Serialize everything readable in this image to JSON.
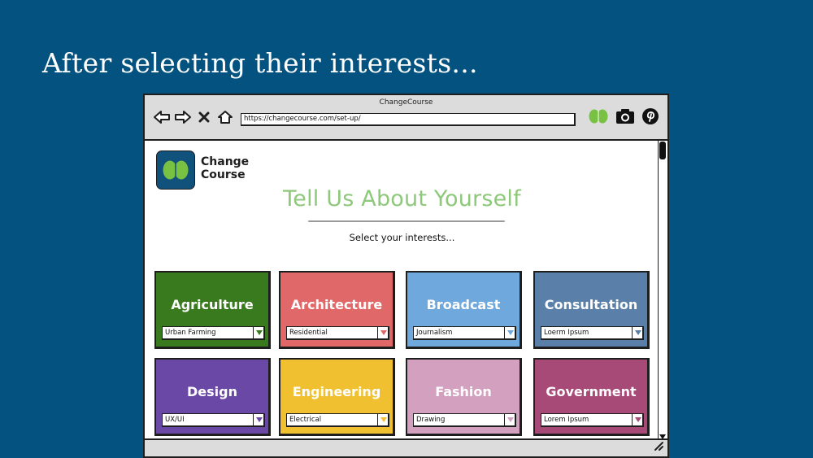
{
  "slide": {
    "title": "After selecting their interests..."
  },
  "browser": {
    "window_title": "ChangeCourse",
    "url": "https://changecourse.com/set-up/",
    "icons": [
      "back-arrow-icon",
      "forward-arrow-icon",
      "close-icon",
      "home-icon",
      "bookmark-logo-icon",
      "camera-icon",
      "pinterest-icon"
    ]
  },
  "page": {
    "logo_line1": "Change",
    "logo_line2": "Course",
    "heading": "Tell Us About Yourself",
    "subheading": "Select your interests..."
  },
  "colors": {
    "slide_bg": "#03527f",
    "heading": "#8ec87a",
    "logo_bg": "#10527c",
    "logo_green": "#79c142"
  },
  "interests": [
    {
      "label": "Agriculture",
      "selection": "Urban Farming",
      "color": "#3a7a1e"
    },
    {
      "label": "Architecture",
      "selection": "Residential",
      "color": "#e06868"
    },
    {
      "label": "Broadcast",
      "selection": "Journalism",
      "color": "#6fa8dc"
    },
    {
      "label": "Consultation",
      "selection": "Loerm Ipsum",
      "color": "#5a7fa8"
    },
    {
      "label": "Design",
      "selection": "UX/UI",
      "color": "#6a48a6"
    },
    {
      "label": "Engineering",
      "selection": "Electrical",
      "color": "#f0c030"
    },
    {
      "label": "Fashion",
      "selection": "Drawing",
      "color": "#d4a0c0"
    },
    {
      "label": "Government",
      "selection": "Lorem Ipsum",
      "color": "#a84a78"
    }
  ]
}
